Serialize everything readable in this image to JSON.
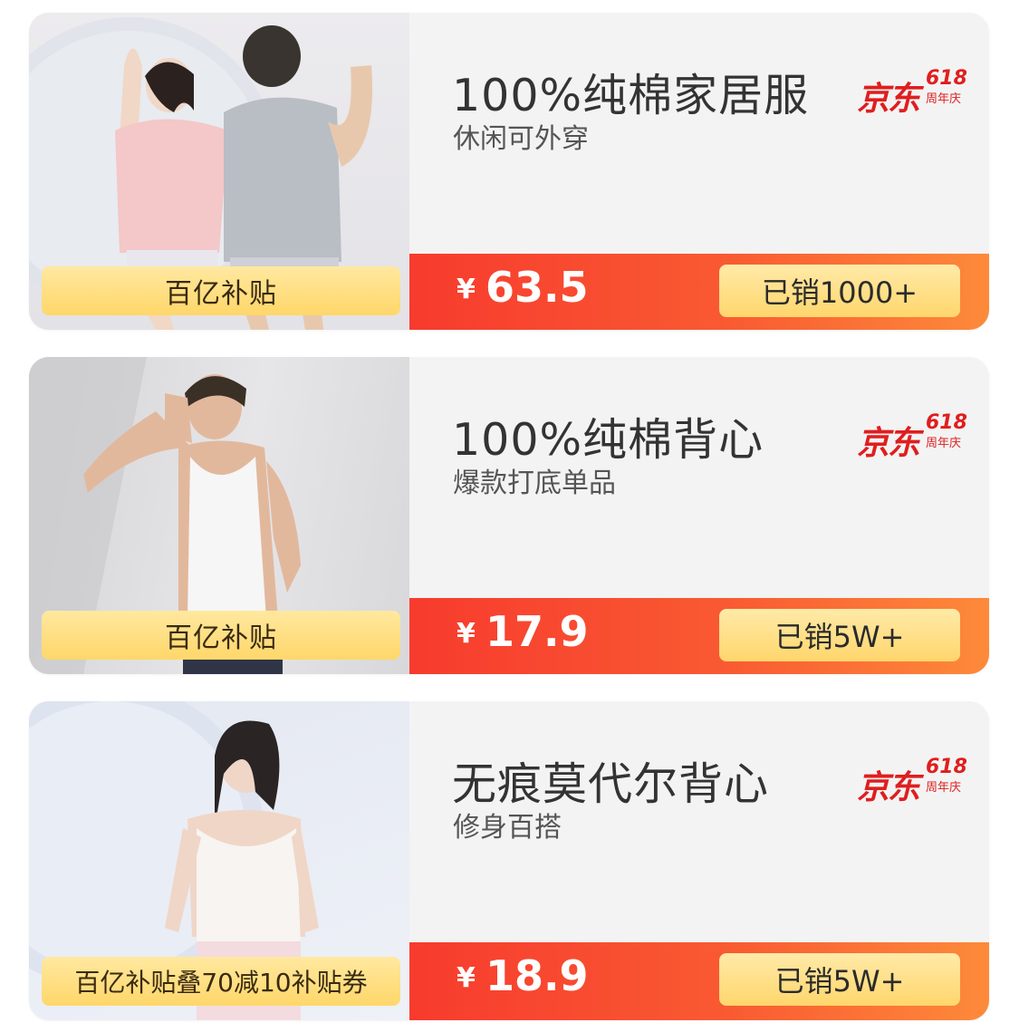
{
  "colors": {
    "price_bar_start": "#f73b2e",
    "price_bar_end": "#fd8a3a",
    "badge_yellow": "#ffd76a",
    "jd_red": "#e01e1e"
  },
  "products": [
    {
      "title": "100%纯棉家居服",
      "subtitle": "休闲可外穿",
      "badge": "百亿补贴",
      "currency": "¥",
      "price": "63.5",
      "sold": "已销1000+",
      "logo": {
        "main": "京东",
        "number": "618",
        "sub": "周年庆"
      },
      "image": "couple-pajamas-photo"
    },
    {
      "title": "100%纯棉背心",
      "subtitle": "爆款打底单品",
      "badge": "百亿补贴",
      "currency": "¥",
      "price": "17.9",
      "sold": "已销5W+",
      "logo": {
        "main": "京东",
        "number": "618",
        "sub": "周年庆"
      },
      "image": "man-tank-top-photo"
    },
    {
      "title": "无痕莫代尔背心",
      "subtitle": "修身百搭",
      "badge": "百亿补贴叠70减10补贴券",
      "currency": "¥",
      "price": "18.9",
      "sold": "已销5W+",
      "logo": {
        "main": "京东",
        "number": "618",
        "sub": "周年庆"
      },
      "image": "woman-camisole-photo"
    }
  ]
}
